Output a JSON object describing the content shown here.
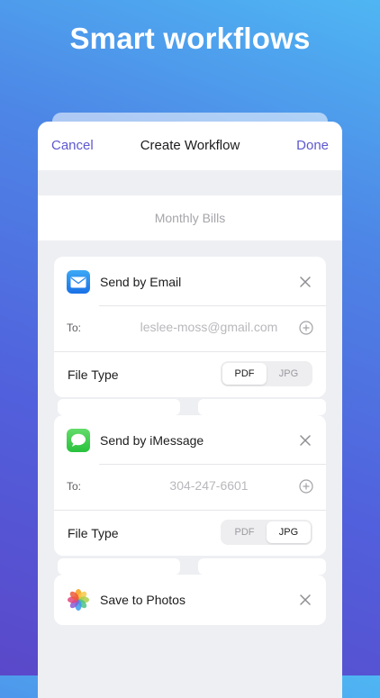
{
  "headline": "Smart workflows",
  "navbar": {
    "cancel_label": "Cancel",
    "title": "Create Workflow",
    "done_label": "Done"
  },
  "workflow_name": {
    "placeholder": "Monthly Bills"
  },
  "actions": [
    {
      "title": "Send by Email",
      "icon": "mail-icon",
      "to_label": "To:",
      "to_placeholder": "leslee-moss@gmail.com",
      "file_type_label": "File Type",
      "options": [
        "PDF",
        "JPG"
      ],
      "selected": "PDF"
    },
    {
      "title": "Send by iMessage",
      "icon": "message-icon",
      "to_label": "To:",
      "to_placeholder": "304-247-6601",
      "file_type_label": "File Type",
      "options": [
        "PDF",
        "JPG"
      ],
      "selected": "JPG"
    },
    {
      "title": "Save to Photos",
      "icon": "photos-icon"
    }
  ],
  "colors": {
    "accent": "#5d58cf",
    "background_top": "#4fb6f3",
    "background_bottom": "#5a48c9"
  }
}
